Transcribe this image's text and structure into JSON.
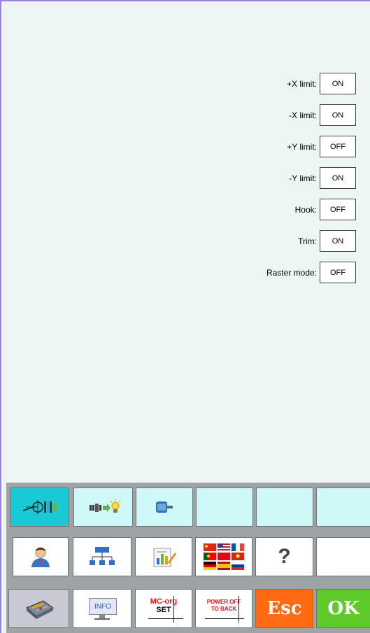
{
  "status": {
    "items": [
      {
        "label": "+X limit:",
        "value": "ON"
      },
      {
        "label": "-X limit:",
        "value": "ON"
      },
      {
        "label": "+Y limit:",
        "value": "OFF"
      },
      {
        "label": "-Y limit:",
        "value": "ON"
      },
      {
        "label": "Hook:",
        "value": "OFF"
      },
      {
        "label": "Trim:",
        "value": "ON"
      },
      {
        "label": "Raster mode:",
        "value": "OFF"
      }
    ]
  },
  "toolbar": {
    "row1": [
      {
        "icon": "io-port-icon",
        "active": true
      },
      {
        "icon": "output-light-icon",
        "active": false
      },
      {
        "icon": "motor-icon",
        "active": false
      },
      {
        "icon": "",
        "active": false
      },
      {
        "icon": "",
        "active": false
      },
      {
        "icon": "",
        "active": false
      }
    ],
    "row2": [
      {
        "icon": "user-icon"
      },
      {
        "icon": "network-icon"
      },
      {
        "icon": "report-icon"
      },
      {
        "icon": "language-flags-icon"
      },
      {
        "icon": "help-icon",
        "text": "?"
      },
      {
        "icon": ""
      }
    ],
    "row3": {
      "tools_icon": "toolbox-icon",
      "info_label": "INFO",
      "mcorg_line1": "MC-org",
      "mcorg_line2": "SET",
      "power_line1": "POWER OFF",
      "power_line2": "TO BACK",
      "esc_label": "Esc",
      "ok_label": "OK"
    }
  },
  "colors": {
    "border_accent": "#9a86d8",
    "active_tab": "#19c9d6",
    "tab_bg": "#cff9f9",
    "esc": "#ff6a13",
    "ok": "#5ecb2a"
  }
}
